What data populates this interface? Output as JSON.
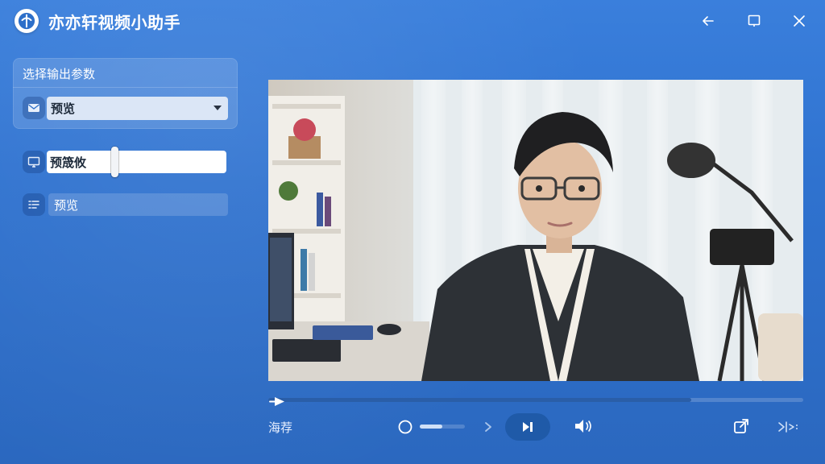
{
  "titlebar": {
    "title": "亦亦轩视频小助手"
  },
  "panel": {
    "section_title": "选择输出参数",
    "select_value": "预览",
    "input_value": "预筬攸",
    "field_value": "预览"
  },
  "player": {
    "progress": 0.79,
    "volume": 0.5,
    "bottom_label": "海荐"
  },
  "colors": {
    "background": "#2d6fc9",
    "play_button": "#1f5aa8"
  },
  "icons": [
    "app-logo-icon",
    "back-arrow-icon",
    "window-icon",
    "close-icon",
    "mail-icon",
    "monitor-icon",
    "list-icon",
    "circle-icon",
    "chevron-right-icon",
    "play-next-icon",
    "volume-icon",
    "share-icon",
    "exit-icon"
  ]
}
